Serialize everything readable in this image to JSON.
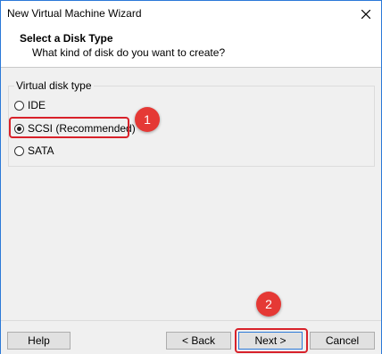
{
  "window": {
    "title": "New Virtual Machine Wizard",
    "close_icon": "close-icon"
  },
  "header": {
    "title": "Select a Disk Type",
    "subtitle": "What kind of disk do you want to create?"
  },
  "group": {
    "legend": "Virtual disk type",
    "options": [
      {
        "label": "IDE",
        "selected": false
      },
      {
        "label": "SCSI  (Recommended)",
        "selected": true
      },
      {
        "label": "SATA",
        "selected": false
      }
    ]
  },
  "annotations": {
    "step1": "1",
    "step2": "2",
    "color": "#e53935"
  },
  "footer": {
    "help_label": "Help",
    "back_label": "< Back",
    "next_label": "Next >",
    "cancel_label": "Cancel"
  }
}
